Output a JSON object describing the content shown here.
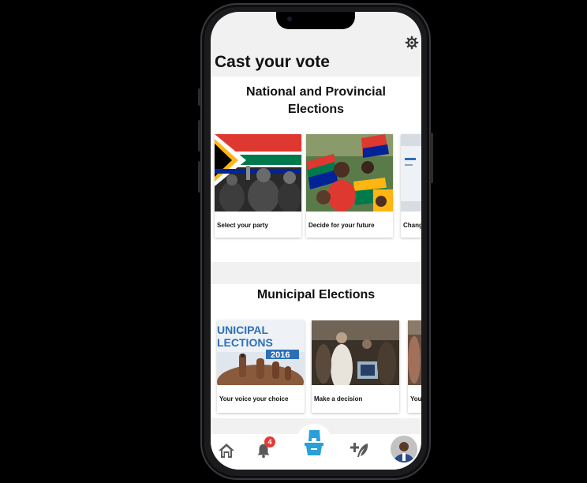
{
  "header": {
    "title": "Cast your vote",
    "settings_icon": "gear-icon"
  },
  "national": {
    "title_line1": "National and Provincial",
    "title_line2": "Elections",
    "cards": [
      {
        "label": "Select your party"
      },
      {
        "label": "Decide for your future"
      },
      {
        "label": "Chang"
      }
    ]
  },
  "municipal": {
    "title": "Municipal Elections",
    "cards": [
      {
        "label": "Your voice your choice",
        "image_text_1": "UNICIPAL",
        "image_text_2": "LECTIONS",
        "image_text_3": "2016"
      },
      {
        "label": "Make a decision"
      },
      {
        "label": "Your"
      }
    ]
  },
  "bottom_nav": {
    "home_icon": "home-icon",
    "notifications_icon": "bell-icon",
    "notification_count": "4",
    "vote_icon": "ballot-box-icon",
    "add_icon": "add-feather-icon",
    "profile_icon": "avatar"
  },
  "colors": {
    "accent": "#29a0d9",
    "badge": "#e53935",
    "page_bg": "#f1f1f1",
    "section_bg": "#ffffff"
  }
}
